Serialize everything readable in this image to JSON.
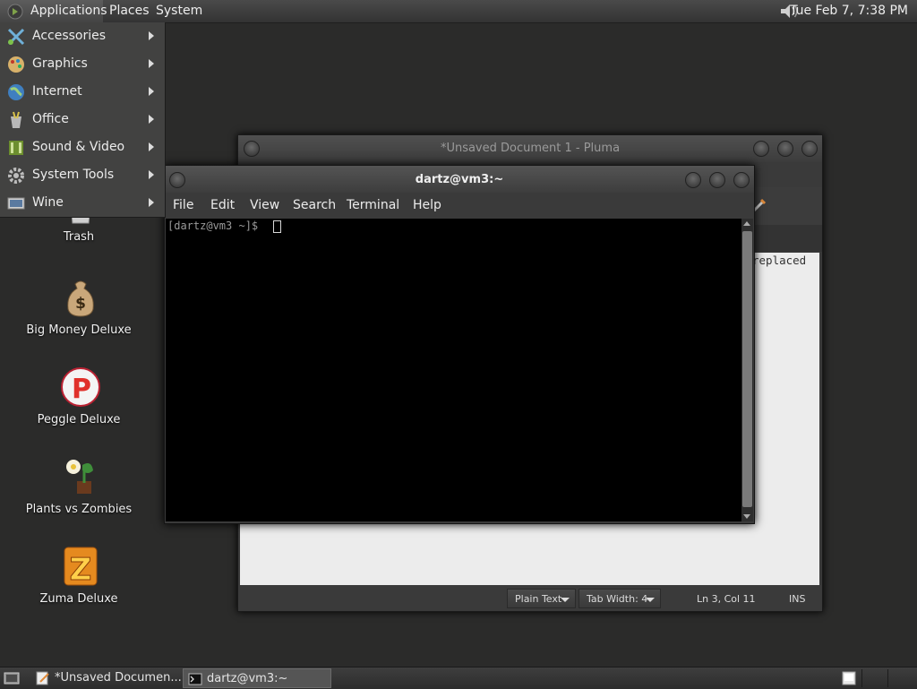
{
  "top_panel": {
    "applications": "Applications",
    "places": "Places",
    "system": "System",
    "clock": "Tue Feb  7, 7:38 PM"
  },
  "applications_menu": {
    "items": [
      {
        "label": "Accessories",
        "icon": "accessories-icon"
      },
      {
        "label": "Graphics",
        "icon": "graphics-icon"
      },
      {
        "label": "Internet",
        "icon": "internet-icon"
      },
      {
        "label": "Office",
        "icon": "office-icon"
      },
      {
        "label": "Sound & Video",
        "icon": "sound-video-icon"
      },
      {
        "label": "System Tools",
        "icon": "system-tools-icon"
      },
      {
        "label": "Wine",
        "icon": "wine-icon"
      }
    ]
  },
  "desktop_icons": [
    {
      "label": "Trash",
      "icon": "trash-icon"
    },
    {
      "label": "Big Money Deluxe",
      "icon": "money-bag-icon"
    },
    {
      "label": "Peggle Deluxe",
      "icon": "peggle-icon"
    },
    {
      "label": "Plants vs Zombies",
      "icon": "plants-icon"
    },
    {
      "label": "Zuma Deluxe",
      "icon": "zuma-icon"
    }
  ],
  "pluma": {
    "title": "*Unsaved Document 1 - Pluma",
    "visible_text": "replaced",
    "status": {
      "language": "Plain Text",
      "tab_width": "Tab Width:  4",
      "position": "Ln 3, Col 11",
      "mode": "INS"
    }
  },
  "terminal": {
    "title": "dartz@vm3:~",
    "menu": [
      "File",
      "Edit",
      "View",
      "Search",
      "Terminal",
      "Help"
    ],
    "prompt": "[dartz@vm3 ~]$"
  },
  "taskbar": {
    "tasks": [
      {
        "label": "*Unsaved Documen...",
        "icon": "text-editor-icon"
      },
      {
        "label": "dartz@vm3:~",
        "icon": "terminal-icon"
      }
    ]
  },
  "colors": {
    "desktop": "#2b2b2a",
    "panel": "#3a3a3a",
    "terminal_bg": "#000000",
    "document_bg": "#ececec"
  }
}
